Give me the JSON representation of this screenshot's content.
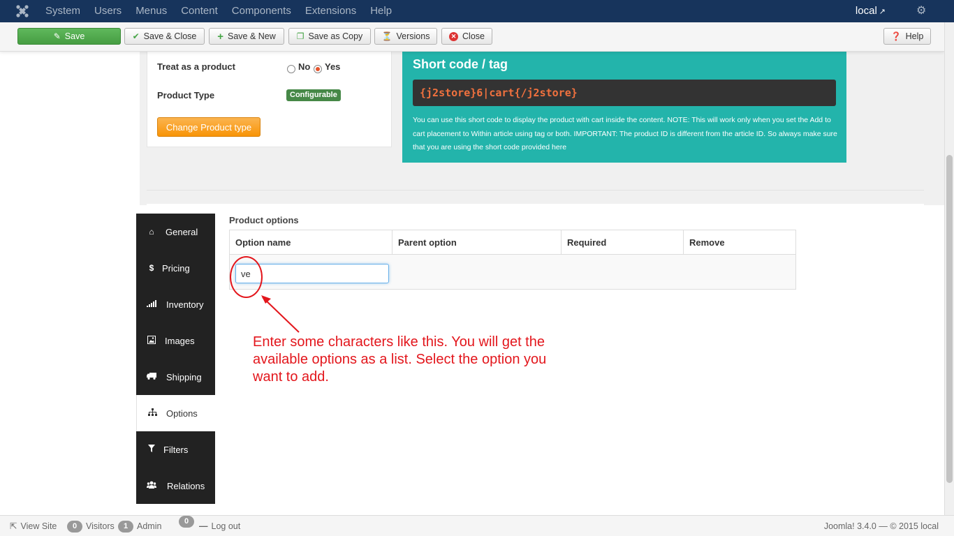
{
  "navbar": {
    "menu": [
      "System",
      "Users",
      "Menus",
      "Content",
      "Components",
      "Extensions",
      "Help"
    ],
    "site_link": "local"
  },
  "toolbar": {
    "save": "Save",
    "save_close": "Save & Close",
    "save_new": "Save & New",
    "save_copy": "Save as Copy",
    "versions": "Versions",
    "close": "Close",
    "help": "Help"
  },
  "product": {
    "treat_label": "Treat as a product",
    "no_label": "No",
    "yes_label": "Yes",
    "selected": "Yes",
    "type_label": "Product Type",
    "type_value": "Configurable",
    "change_type_button": "Change Product type"
  },
  "shortcode": {
    "title": "Short code / tag",
    "code": "{j2store}6|cart{/j2store}",
    "note": "You can use this short code to display the product with cart inside the content. NOTE: This will work only when you set the Add to cart placement to Within article using tag or both. IMPORTANT: The product ID is different from the article ID. So always make sure that you are using the short code provided here"
  },
  "tabs": [
    {
      "label": "General",
      "icon": "home-icon"
    },
    {
      "label": "Pricing",
      "icon": "dollar-icon"
    },
    {
      "label": "Inventory",
      "icon": "signal-bars-icon"
    },
    {
      "label": "Images",
      "icon": "image-icon"
    },
    {
      "label": "Shipping",
      "icon": "truck-icon"
    },
    {
      "label": "Options",
      "icon": "sitemap-icon"
    },
    {
      "label": "Filters",
      "icon": "filter-icon"
    },
    {
      "label": "Relations",
      "icon": "users-icon"
    }
  ],
  "active_tab": "Options",
  "options": {
    "title": "Product options",
    "columns": [
      "Option name",
      "Parent option",
      "Required",
      "Remove"
    ],
    "input_value": "ve"
  },
  "annotation": {
    "text": "Enter some characters like this. You will get the available options as a list. Select the option you want to add.",
    "color": "#e3161c"
  },
  "statusbar": {
    "view_site": "View Site",
    "visitors_count": "0",
    "visitors_label": "Visitors",
    "admin_count": "1",
    "admin_label": "Admin",
    "messages_count": "0",
    "logout": "Log out",
    "version": "Joomla! 3.4.0 — © 2015 local"
  }
}
